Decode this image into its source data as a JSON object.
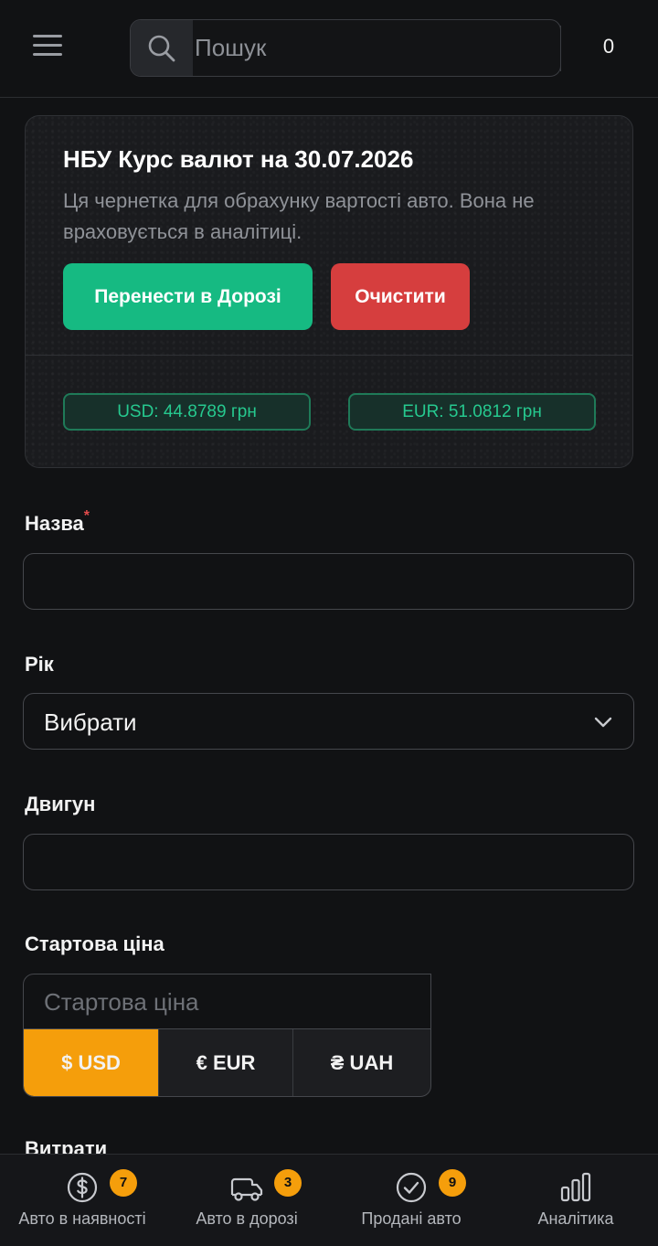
{
  "header": {
    "search_placeholder": "Пошук",
    "count": "0"
  },
  "rate_card": {
    "title": "НБУ Курс валют на 30.07.2026",
    "description": "Ця чернетка для обрахунку вартості авто. Вона не враховується в аналітиці.",
    "transfer_button": "Перенести в Дорозі",
    "clear_button": "Очистити",
    "usd_rate": "USD: 44.8789 грн",
    "eur_rate": "EUR: 51.0812 грн"
  },
  "form": {
    "name_label": "Назва",
    "name_required_mark": "*",
    "name_value": "",
    "year_label": "Рік",
    "year_value": "Вибрати",
    "engine_label": "Двигун",
    "engine_value": "",
    "start_price_label": "Стартова ціна",
    "start_price_placeholder": "Стартова ціна",
    "currencies": [
      "$ USD",
      "€ EUR",
      "₴ UAH"
    ],
    "selected_currency": "$ USD",
    "expenses_label": "Витрати"
  },
  "bottom_nav": [
    {
      "label": "Авто в наявності",
      "badge": "7",
      "icon": "dollar-circle-icon"
    },
    {
      "label": "Авто в дорозі",
      "badge": "3",
      "icon": "truck-icon"
    },
    {
      "label": "Продані авто",
      "badge": "9",
      "icon": "check-circle-icon"
    },
    {
      "label": "Аналітика",
      "badge": "",
      "icon": "bar-chart-icon"
    }
  ],
  "colors": {
    "background": "#111214",
    "accent_orange": "#f59e0b",
    "green": "#16ba82",
    "red": "#d63e3e",
    "rate_text": "#26c98f"
  }
}
